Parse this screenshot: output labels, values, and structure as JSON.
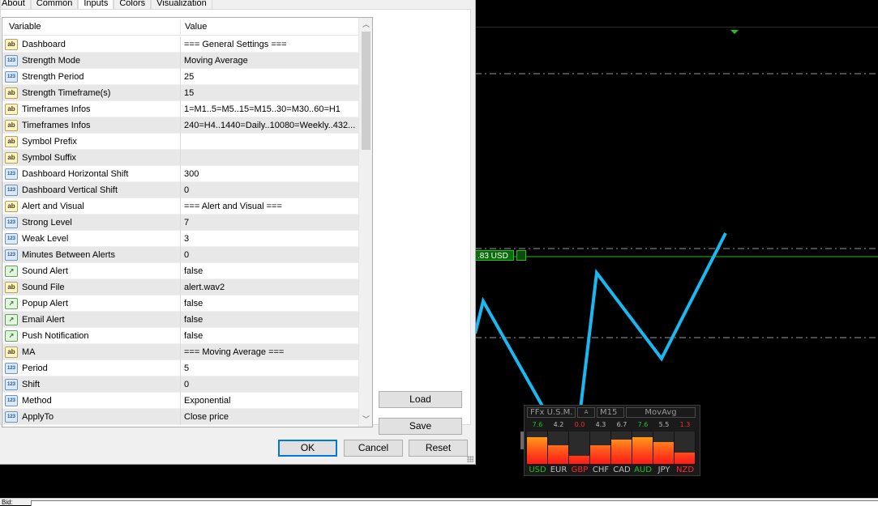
{
  "dialog": {
    "tabs": [
      "About",
      "Common",
      "Inputs",
      "Colors",
      "Visualization"
    ],
    "active_tab": "Inputs",
    "columns": {
      "variable": "Variable",
      "value": "Value"
    },
    "rows": [
      {
        "type": "ab",
        "variable": "Dashboard",
        "value": "=== General Settings ==="
      },
      {
        "type": "123",
        "variable": "Strength Mode",
        "value": "Moving Average"
      },
      {
        "type": "123",
        "variable": "Strength Period",
        "value": "25"
      },
      {
        "type": "ab",
        "variable": "Strength Timeframe(s)",
        "value": "15"
      },
      {
        "type": "ab",
        "variable": "Timeframes Infos",
        "value": "1=M1..5=M5..15=M15..30=M30..60=H1"
      },
      {
        "type": "ab",
        "variable": "Timeframes Infos",
        "value": "240=H4..1440=Daily..10080=Weekly..432..."
      },
      {
        "type": "ab",
        "variable": "Symbol Prefix",
        "value": ""
      },
      {
        "type": "ab",
        "variable": "Symbol Suffix",
        "value": ""
      },
      {
        "type": "123",
        "variable": "Dashboard Horizontal Shift",
        "value": "300"
      },
      {
        "type": "123",
        "variable": "Dashboard Vertical Shift",
        "value": "0"
      },
      {
        "type": "ab",
        "variable": "Alert and Visual",
        "value": "=== Alert and Visual ==="
      },
      {
        "type": "123",
        "variable": "Strong Level",
        "value": "7"
      },
      {
        "type": "123",
        "variable": "Weak Level",
        "value": "3"
      },
      {
        "type": "123",
        "variable": "Minutes Between Alerts",
        "value": "0"
      },
      {
        "type": "bool",
        "variable": "Sound Alert",
        "value": "false"
      },
      {
        "type": "ab",
        "variable": "Sound File",
        "value": "alert.wav2"
      },
      {
        "type": "bool",
        "variable": "Popup Alert",
        "value": "false"
      },
      {
        "type": "bool",
        "variable": "Email Alert",
        "value": "false"
      },
      {
        "type": "bool",
        "variable": "Push Notification",
        "value": "false"
      },
      {
        "type": "ab",
        "variable": "MA",
        "value": "=== Moving Average ==="
      },
      {
        "type": "123",
        "variable": "Period",
        "value": "5"
      },
      {
        "type": "123",
        "variable": "Shift",
        "value": "0"
      },
      {
        "type": "123",
        "variable": "Method",
        "value": "Exponential"
      },
      {
        "type": "123",
        "variable": "ApplyTo",
        "value": "Close price"
      }
    ],
    "icon_labels": {
      "ab": "ab",
      "123": "123",
      "bool": "↗"
    },
    "buttons": {
      "load": "Load",
      "save": "Save",
      "ok": "OK",
      "cancel": "Cancel",
      "reset": "Reset"
    }
  },
  "chart": {
    "price_label": ".83 USD",
    "line_color": "#1ab8f0",
    "price_line_color": "#21c021"
  },
  "dashboard": {
    "header": [
      "FFx U.S.M.",
      "A",
      "M15",
      "MovAvg"
    ],
    "currencies": [
      {
        "name": "USD",
        "value": "7.6",
        "strength": 0.76,
        "color": "#22c022"
      },
      {
        "name": "EUR",
        "value": "4.2",
        "strength": 0.42,
        "color": "#bdbdbd"
      },
      {
        "name": "GBP",
        "value": "0.0",
        "strength": 0.0,
        "color": "#ff2a2a"
      },
      {
        "name": "CHF",
        "value": "4.3",
        "strength": 0.43,
        "color": "#bdbdbd"
      },
      {
        "name": "CAD",
        "value": "6.7",
        "strength": 0.67,
        "color": "#bdbdbd"
      },
      {
        "name": "AUD",
        "value": "7.6",
        "strength": 0.76,
        "color": "#22c022"
      },
      {
        "name": "JPY",
        "value": "5.5",
        "strength": 0.55,
        "color": "#bdbdbd"
      },
      {
        "name": "NZD",
        "value": "1.3",
        "strength": 0.13,
        "color": "#ff2a2a"
      }
    ]
  },
  "bottom_bar": {
    "text": "Bid:"
  }
}
